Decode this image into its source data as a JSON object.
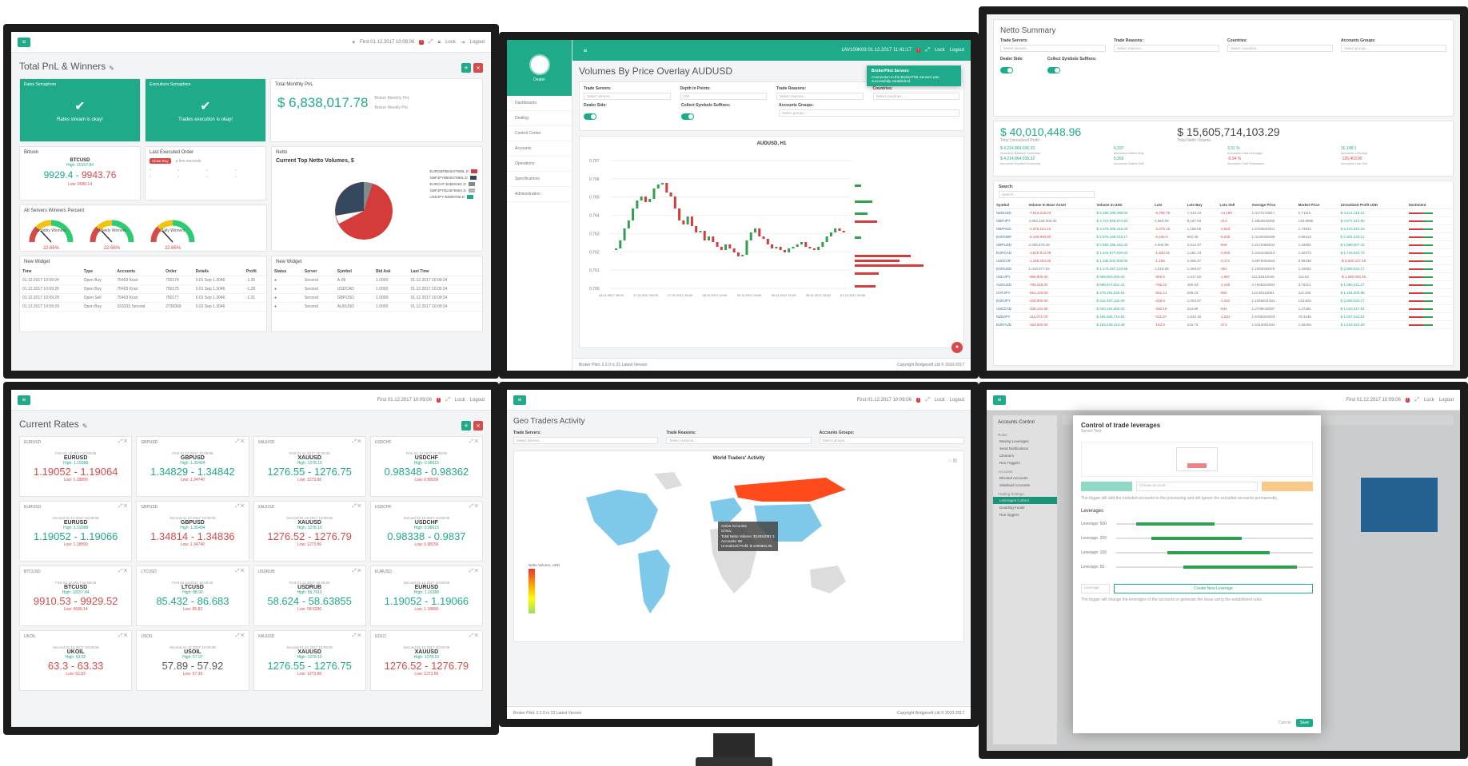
{
  "pnl": {
    "title": "Total PnL & Winners",
    "rates_semaphore": {
      "title": "Rates Semaphore",
      "msg": "Rates stream is okay!"
    },
    "exec_semaphore": {
      "title": "Executions Semaphore",
      "msg": "Trades execution is okay!"
    },
    "monthly": {
      "title": "Total Monthly PnL",
      "value": "$ 6,838,017.78",
      "side1": "Broker Monthly PnL",
      "side2": "Broker Weekly PnL"
    },
    "bitcoin": {
      "title": "Bitcoin",
      "symbol": "BTCUSD",
      "high": "High: 10157.84",
      "low": "Low: 9686.14",
      "bid": "9929.4",
      "sep": " - ",
      "ask": "9943.76"
    },
    "last_order": {
      "title": "Last Executed Order",
      "badge": "Close Buy",
      "when": "a few seconds"
    },
    "winners": {
      "title": "All Servers Winners Percent",
      "gauges": [
        {
          "label": "Monthly Winners",
          "value": "22.66%"
        },
        {
          "label": "Weekly Winners",
          "value": "22.66%"
        },
        {
          "label": "Daily Winners",
          "value": "22.66%"
        }
      ]
    },
    "netto": {
      "title": "Netto",
      "chart_title": "Current Top Netto Volumes, $",
      "legend": [
        "EURGBP$84047998L.D",
        "GBPJPY$84047998L.D",
        "EURCHF $1$5016C.D",
        "GBPJPY$1487596A.D",
        "USDJPY $4860786.D"
      ]
    },
    "new_widget_a": {
      "title": "New Widget",
      "cols": [
        "Time",
        "Type",
        "Accounts",
        "Order",
        "Details",
        "Profit"
      ],
      "rows": [
        [
          "01.12.2017 10:09:24",
          "Open Buy",
          "75403 Knat",
          "750174",
          "0.01 Sep 1.3046",
          "-1.35"
        ],
        [
          "01.12.2017 10:09:26",
          "Open Buy",
          "75403 Knat",
          "750175",
          "0.01 Sep 1.3046",
          "-1.28"
        ],
        [
          "01.12.2017 10:09:29",
          "Open Sell",
          "75403 Knat",
          "750177",
          "0.01 Sep 1.3046",
          "-1.31"
        ],
        [
          "01.12.2017 10:09:29",
          "Open Buy",
          "333333 Second",
          "2736969",
          "0.02 Sep 1.3046",
          ""
        ]
      ]
    },
    "new_widget_b": {
      "title": "New Widget",
      "cols": [
        "Status",
        "Server",
        "Symbol",
        "Bid Ask",
        "Last Time"
      ],
      "rows": [
        [
          "Second",
          "A-09",
          "1.0000",
          "01.12.2017 10:09:24"
        ],
        [
          "Second",
          "USDCAD",
          "1.0000",
          "01.12.2017 10:09:24"
        ],
        [
          "Second",
          "GBPUSD",
          "1.0000",
          "01.12.2017 10:09:24"
        ],
        [
          "Second",
          "AUDUSD",
          "1.0000",
          "01.12.2017 10:09:24"
        ]
      ]
    },
    "topbar": {
      "user": "First 01.12.2017 10:09:06",
      "lock": "Lock",
      "logout": "Logout"
    }
  },
  "volumes": {
    "title": "Volumes By Price Overlay AUDUSD",
    "topbar": {
      "user": "1AV100K03 01.12.2017 11:41:17",
      "lock": "Lock",
      "logout": "Logout"
    },
    "nav": [
      "Dashboards",
      "Dealing",
      "Control Center",
      "Accounts",
      "Operations",
      "Specifications",
      "Administration"
    ],
    "dealer": "Dealer",
    "filters": [
      {
        "label": "Trade Servers:",
        "value": "Select servers..."
      },
      {
        "label": "Depth in Points:",
        "value": "100"
      },
      {
        "label": "Trade Reasons:",
        "value": "Select reasons..."
      },
      {
        "label": "Countries:",
        "value": "Select countries..."
      }
    ],
    "dealer_side": "Dealer Side:",
    "collect_suffixes": "Collect Symbols Suffixes:",
    "account_groups": {
      "label": "Accounts Groups:",
      "value": "Select groups..."
    },
    "chart_title": "AUDUSD, H1",
    "toast_title": "BrokerPilot Servers",
    "toast_msg": "Connection to the BrokerPilot Servers was successfully established.",
    "footer_left": "Broker Pilot: 2.2.0 rc 21 Latest Version",
    "footer_right": "Copyright Bridgesoft Ltd © 2010-2017",
    "price_ticks": [
      "0.767",
      "0.766",
      "0.765",
      "0.764",
      "0.763",
      "0.762",
      "0.761",
      "0.760"
    ],
    "time_ticks": [
      "24.11.2017 03:00",
      "27.11.2017 00:00",
      "27.11.2017 16:00",
      "28.11.2017 10:00",
      "29.11.2017 04:00",
      "29.11.2017 21:00",
      "30.11.2017 15:00",
      "01.12.2017 09:00"
    ]
  },
  "netto_summary": {
    "title": "Netto Summary",
    "filters": [
      {
        "label": "Trade Servers:",
        "value": "Select servers..."
      },
      {
        "label": "Trade Reasons:",
        "value": "Select reasons..."
      },
      {
        "label": "Countries:",
        "value": "Select countries..."
      },
      {
        "label": "Accounts Groups:",
        "value": "Select groups..."
      }
    ],
    "dealer_side": "Dealer Side:",
    "collect": "Collect Symbols Suffixes:",
    "big1": "$ 40,010,448.96",
    "big1_label": "Total Unrealized Profit",
    "big2": "$ 15,605,714,103.29",
    "big2_label": "Total Netto Volume",
    "stats": [
      {
        "v": "$ 4,214,864,036.32",
        "l": "Accounts Balance Summary"
      },
      {
        "v": "6,337",
        "l": "Accounts Orders Buy"
      },
      {
        "v": "3.31 %",
        "l": "Accounts Total Leverage"
      },
      {
        "v": "16,148.1",
        "l": "Accounts Lots Buy"
      },
      {
        "v": "$ 4,214,864,036.32",
        "l": "Accounts Equities Summary"
      },
      {
        "v": "5,356",
        "l": "Accounts Orders Sell"
      },
      {
        "v": "-0.94 %",
        "l": "Accounts Total Drawdown"
      },
      {
        "v": "-126,403.95",
        "l": "Accounts Lots Sell"
      }
    ],
    "search": "Search:",
    "search_ph": "Search...",
    "cols": [
      "Symbol",
      "Volume In Base Asset",
      "Volume In USD",
      "Lots",
      "Lots Buy",
      "Lots Sell",
      "Average Price",
      "Market Price",
      "Unrealized Profit USD",
      "Sentiment"
    ],
    "rows": [
      [
        "NZDUSD",
        "-7,513,218.23",
        "$ 5,158,289,398.84",
        "-6,785.79",
        "7,413.34",
        "-14,199",
        "1.0171713817",
        "0.71113",
        "$ 3,414,116.12",
        ""
      ],
      [
        "GBPJPY",
        "4,983,139,000.00",
        "$ 3,713,968,874.82",
        "4,983.06",
        "5,197.03",
        "-214",
        "1.4863519395",
        "148.9995",
        "$ 4,877,314.90",
        ""
      ],
      [
        "GBPAUD",
        "-2,375,164.12",
        "$ 3,379,386,416.03",
        "-2,375.16",
        "1,188.09",
        "-3,563",
        "1.5783920401",
        "1.74943",
        "$ 2,419,810.19",
        ""
      ],
      [
        "EURGBP",
        "-5,165,900.00",
        "$ 2,976,188,019.17",
        "-5,165.9",
        "862.39",
        "-6,028",
        "1.0130306399",
        "0.88413",
        "$ 2,301,443.11",
        ""
      ],
      [
        "GBPUSD",
        "2,006,978.48",
        "$ 2,694,396,441.34",
        "2,006.98",
        "2,513.37",
        "-506",
        "1.3170386534",
        "1.34652",
        "$ 1,980,007.42",
        ""
      ],
      [
        "EURCAD",
        "-1,820,914.09",
        "$ 1,431,977,030.64",
        "-1,820.91",
        "1,181.23",
        "-3,002",
        "1.3151038313",
        "1.50373",
        "$ 1,719,024.72",
        ""
      ],
      [
        "USDCHF",
        "-1,165,004.00",
        "$ 1,165,004,000.00",
        "-1,165",
        "2,006.37",
        "-3,171",
        "0.9875004003",
        "0.98338",
        "-$ 3,250,317.48",
        ""
      ],
      [
        "EURUSD",
        "1,018,977.84",
        "$ 1,173,497,120.68",
        "1,018.98",
        "1,409.67",
        "-391",
        "1.1003039378",
        "1.19052",
        "$ 2,009,034.17",
        ""
      ],
      [
        "USDJPY",
        "-969,900.00",
        "$ 969,900,000.00",
        "-969.9",
        "1,017.52",
        "-1,987",
        "111.62810049",
        "112.52",
        "-$ 1,060,003.46",
        ""
      ],
      [
        "AUDUSD",
        "-785,218.00",
        "$ 595,874,931.21",
        "-785.22",
        "406.93",
        "-1,192",
        "0.7648303094",
        "0.76114",
        "$ 1,090,411.27",
        ""
      ],
      [
        "CHFJPY",
        "-551,140.00",
        "$ 478,291,032.91",
        "-551.14",
        "299.23",
        "-850",
        "113.56113081",
        "114.405",
        "$ 1,194,304.96",
        ""
      ],
      [
        "EURJPY",
        "-428,900.00",
        "$ 416,497,132.09",
        "-428.9",
        "1,004.87",
        "-1,434",
        "1.1046831381",
        "133.943",
        "$ 2,009,034.17",
        ""
      ],
      [
        "USDCAD",
        "-330,191.55",
        "$ 330,191,550.00",
        "-330.19",
        "213.69",
        "-544",
        "1.2709015497",
        "1.27281",
        "$ 1,010,417.61",
        ""
      ],
      [
        "NZDJPY",
        "-211,071.00",
        "$ 186,306,714.81",
        "-211.07",
        "1,043.18",
        "-1,254",
        "1.9796304003",
        "78.3445",
        "$ 1,007,331.04",
        ""
      ],
      [
        "EURAUD",
        "-153,900.00",
        "$ 183,236,413.35",
        "-153.9",
        "216.73",
        "-371",
        "1.5413081034",
        "1.56405",
        "$ 1,519,024.26",
        ""
      ]
    ],
    "topbar": {
      "user": "",
      "lock": "Lock",
      "logout": "Logout"
    }
  },
  "current_rates": {
    "title": "Current Rates",
    "topbar": {
      "user": "First 01.12.2017 10:09:06",
      "lock": "Lock",
      "logout": "Logout"
    },
    "cards": [
      {
        "tag": "EURUSD",
        "ts": "First 01.12.2017 10:09:06",
        "sym": "EURUSD",
        "high": "High: 1.19388",
        "low": "Low: 1.18890",
        "bid": "1.19052",
        "sep": " - ",
        "ask": "1.19064",
        "color": "red"
      },
      {
        "tag": "GBPUSD",
        "ts": "First 01.12.2017 10:09:06",
        "sym": "GBPUSD",
        "high": "High: 1.35494",
        "low": "Low: 1.34740",
        "bid": "1.34829",
        "sep": " - ",
        "ask": "1.34842",
        "color": "green"
      },
      {
        "tag": "XAUUSD",
        "ts": "First 01.12.2017 10:09:06",
        "sym": "XAUUSD",
        "high": "High: 1278.10",
        "low": "Low: 1273.86",
        "bid": "1276.55",
        "sep": " - ",
        "ask": "1276.75",
        "color": "green"
      },
      {
        "tag": "USDCHF",
        "ts": "First 01.12.2017 10:09:06",
        "sym": "USDCHF",
        "high": "High: 0.98615",
        "low": "Low: 0.98156",
        "bid": "0.98348",
        "sep": " - ",
        "ask": "0.98362",
        "color": "green"
      },
      {
        "tag": "EURUSD",
        "ts": "Second 01.12.2017 10:09:06",
        "sym": "EURUSD",
        "high": "High: 1.19388",
        "low": "Low: 1.18890",
        "bid": "1.19052",
        "sep": " - ",
        "ask": "1.19066",
        "color": "green"
      },
      {
        "tag": "GBPUSD",
        "ts": "Second 01.12.2017 10:09:06",
        "sym": "GBPUSD",
        "high": "High: 1.35494",
        "low": "Low: 1.34740",
        "bid": "1.34814",
        "sep": " - ",
        "ask": "1.34836",
        "color": "red"
      },
      {
        "tag": "XAUUSD",
        "ts": "Second 01.12.2017 10:09:06",
        "sym": "XAUUSD",
        "high": "High: 1278.10",
        "low": "Low: 1273.86",
        "bid": "1276.52",
        "sep": " - ",
        "ask": "1276.79",
        "color": "red"
      },
      {
        "tag": "USDCHF",
        "ts": "Second 01.12.2017 10:09:06",
        "sym": "USDCHF",
        "high": "High: 0.98615",
        "low": "Low: 0.98156",
        "bid": "0.98338",
        "sep": " - ",
        "ask": "0.9837",
        "color": "green"
      },
      {
        "tag": "BTCUSD",
        "ts": "First 01.12.2017 10:09:06",
        "sym": "BTCUSD",
        "high": "High: 10157.84",
        "low": "Low: 9686.14",
        "bid": "9910.53",
        "sep": " - ",
        "ask": "9929.52",
        "color": "red"
      },
      {
        "tag": "LTCUSD",
        "ts": "First 01.12.2017 10:09:06",
        "sym": "LTCUSD",
        "high": "High: 88.90",
        "low": "Low: 85.82",
        "bid": "85.432",
        "sep": " - ",
        "ask": "86.683",
        "color": "green"
      },
      {
        "tag": "USDRUB",
        "ts": "First 01.12.2017 10:09:06",
        "sym": "USDRUB",
        "high": "High: 58.7610",
        "low": "Low: 58.5290",
        "bid": "58.624",
        "sep": " - ",
        "ask": "58.63855",
        "color": "green"
      },
      {
        "tag": "EURUSD",
        "ts": "Second 01.12.2017 10:09:06",
        "sym": "EURUSD",
        "high": "High: 1.19388",
        "low": "Low: 1.18890",
        "bid": "1.19052",
        "sep": " - ",
        "ask": "1.19066",
        "color": "green"
      },
      {
        "tag": "UKOIL",
        "ts": "Second 01.12.2017 10:09:06",
        "sym": "UKOIL",
        "high": "High: 63.52",
        "low": "Low: 62.83",
        "bid": "63.3",
        "sep": " - ",
        "ask": "63.33",
        "color": "red"
      },
      {
        "tag": "USOIL",
        "ts": "Second 01.12.2017 10:09:06",
        "sym": "USOIL",
        "high": "High: 57.97",
        "low": "Low: 57.39",
        "bid": "57.89",
        "sep": " - ",
        "ask": "57.92",
        "color": "gray"
      },
      {
        "tag": "XAUUSD",
        "ts": "Second 01.12.2017 10:09:06",
        "sym": "XAUUSD",
        "high": "High: 1278.10",
        "low": "Low: 1273.86",
        "bid": "1276.55",
        "sep": " - ",
        "ask": "1276.75",
        "color": "green"
      },
      {
        "tag": "GOLD",
        "ts": "Second 01.12.2017 10:09:06",
        "sym": "XAUUSD",
        "high": "High: 1278.10",
        "low": "Low: 1273.86",
        "bid": "1276.52",
        "sep": " - ",
        "ask": "1276.79",
        "color": "red"
      }
    ]
  },
  "geo": {
    "title": "Geo Traders Activity",
    "topbar": {
      "user": "First 01.12.2017 10:09:06",
      "lock": "Lock",
      "logout": "Logout"
    },
    "filters": [
      {
        "label": "Trade Servers:",
        "value": "Select servers..."
      },
      {
        "label": "Trade Reasons:",
        "value": "Select reasons..."
      },
      {
        "label": "Accounts Groups:",
        "value": "Select groups..."
      }
    ],
    "map_title": "World Traders' Activity",
    "tooltip": [
      "Active Accounts",
      "China:",
      "Total Netto Volume: $14041081.3",
      "Accounts: 89",
      "Unrealized Profit: $-1000981.05"
    ],
    "legend_label": "Netto Volume, USD",
    "footer_left": "Broker Pilot: 2.2.0 rc 23 Latest Version",
    "footer_right": "Copyright Bridgesoft Ltd © 2010-2017"
  },
  "leverage": {
    "topbar": {
      "user": "First 01.12.2017 10:09:06",
      "lock": "Lock",
      "logout": "Logout"
    },
    "side_title": "Accounts Control",
    "side_groups": [
      {
        "h": "Rules",
        "items": [
          "Moving Leverages",
          "Send Notifications",
          "Cleaners",
          "Run Triggers"
        ]
      },
      {
        "h": "Accounts",
        "items": [
          "Blocked Accounts",
          "Sidelined Accounts"
        ]
      },
      {
        "h": "Trading Settings",
        "items": [
          "Leverages Control",
          "Doubling Funds",
          "Run triggers"
        ]
      }
    ],
    "modal_title": "Control of trade leverages",
    "modal_sub": "Server Test",
    "choose_account": "Choose account",
    "note1": "The trigger will add the included accounts to the processing and will ignore the excluded accounts permanently.",
    "leverages_label": "Leverages",
    "rows": [
      "Leverage: 500",
      "Leverage: 200",
      "Leverage: 100",
      "Leverage: 50"
    ],
    "leverage_field": "Leverage",
    "create_btn": "Create New Leverage",
    "note2": "The trigger will change the leverages of the accounts or generate the issue using the established rules.",
    "cancel": "Cancel",
    "save": "Save"
  }
}
